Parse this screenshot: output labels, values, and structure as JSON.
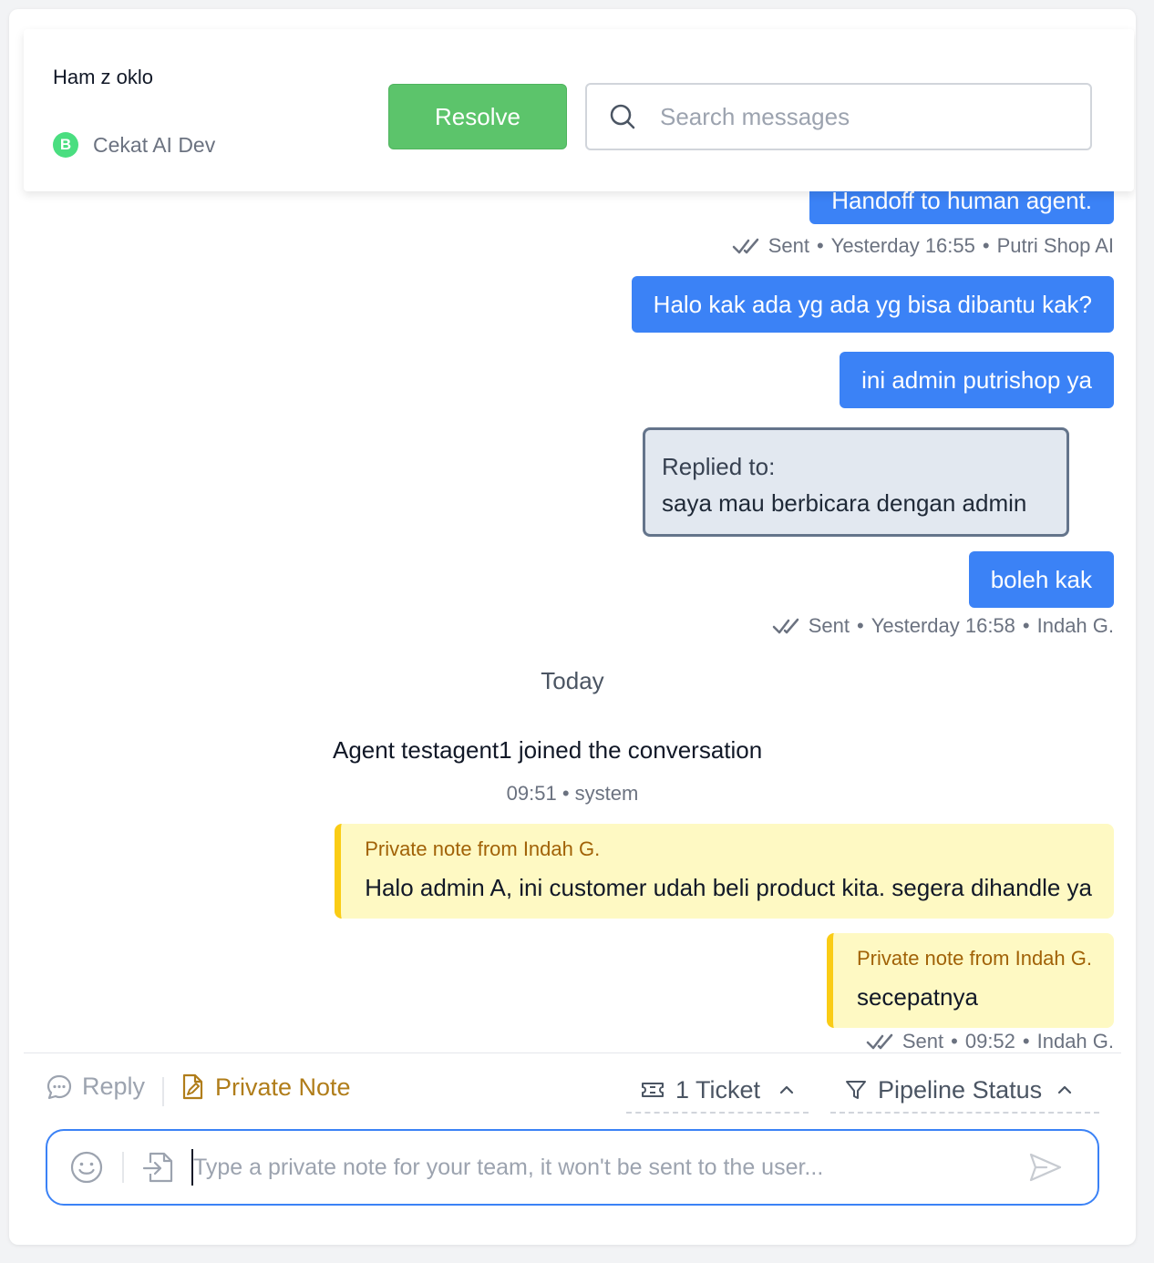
{
  "header": {
    "contact_name": "Ham z oklo",
    "channel_icon_letter": "B",
    "channel_name": "Cekat AI Dev",
    "resolve_label": "Resolve",
    "search_placeholder": "Search messages"
  },
  "messages": [
    {
      "type": "outgoing",
      "text": "Handoff to human agent."
    },
    {
      "type": "meta",
      "status": "Sent",
      "time": "Yesterday 16:55",
      "author": "Putri Shop AI"
    },
    {
      "type": "outgoing",
      "text": "Halo kak ada yg ada yg bisa dibantu kak?"
    },
    {
      "type": "outgoing",
      "text": "ini admin putrishop ya"
    },
    {
      "type": "reply_quote",
      "label": "Replied to:",
      "text": "saya mau berbicara dengan admin"
    },
    {
      "type": "outgoing",
      "text": "boleh kak"
    },
    {
      "type": "meta",
      "status": "Sent",
      "time": "Yesterday 16:58",
      "author": "Indah G."
    },
    {
      "type": "date_divider",
      "text": "Today"
    },
    {
      "type": "system",
      "text": "Agent testagent1 joined the conversation",
      "time": "09:51",
      "author": "system"
    },
    {
      "type": "private_note",
      "from": "Private note from Indah G.",
      "text": "Halo admin A, ini customer udah beli product kita. segera dihandle ya"
    },
    {
      "type": "private_note",
      "from": "Private note from Indah G.",
      "text": "secepatnya"
    },
    {
      "type": "meta",
      "status": "Sent",
      "time": "09:52",
      "author": "Indah G."
    }
  ],
  "composer": {
    "tabs": [
      {
        "label": "Reply",
        "icon": "chat-bubble-icon",
        "active": false
      },
      {
        "label": "Private Note",
        "icon": "note-icon",
        "active": true
      }
    ],
    "ticket_label": "1 Ticket",
    "pipeline_label": "Pipeline Status",
    "placeholder": "Type a private note for your team, it won't be sent to the user..."
  },
  "colors": {
    "bubble": "#3b82f6",
    "resolve": "#5cc46b",
    "note_bg": "#fef9c3",
    "note_border": "#facc15",
    "note_label": "#a16207",
    "private_tab": "#b07d1a",
    "composer_border": "#3b82f6"
  }
}
